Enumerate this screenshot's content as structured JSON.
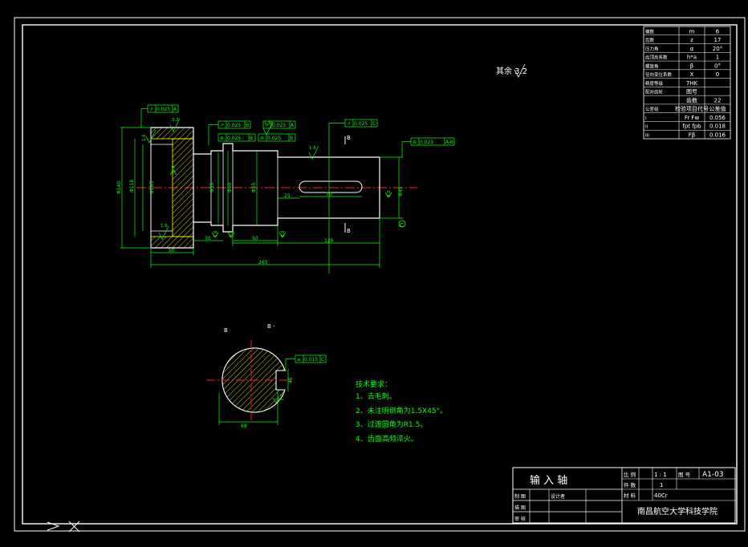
{
  "colors": {
    "background": "#000000",
    "frame": "#ffffff",
    "outline": "#ffffff",
    "dimension": "#00ff00",
    "centerline": "#ff2020",
    "hatch": "#ffff00",
    "text": "#ffffff",
    "note_text": "#00ff00"
  },
  "drawing": {
    "surface_finish_note": "其余 3.2",
    "roughness_values": [
      "3.2",
      "1.6",
      "1.6",
      "1.6",
      "1.6",
      "3.2",
      "3.2",
      "1.6",
      "1.6",
      "3.2",
      "3.2"
    ],
    "tolerance_frames": [
      {
        "symbol": "↗",
        "value": "0.025",
        "datum": "A"
      },
      {
        "symbol": "↗",
        "value": "0.025",
        "datum": "B"
      },
      {
        "symbol": "↗",
        "value": "0.025",
        "datum": "A"
      },
      {
        "symbol": "⊚",
        "value": "0.025",
        "datum": "B"
      },
      {
        "symbol": "⊚",
        "value": "0.025",
        "datum": "B"
      },
      {
        "symbol": "↗",
        "value": "0.025",
        "datum": "C"
      },
      {
        "symbol": "⊚",
        "value": "0.025",
        "datum": "A-B"
      },
      {
        "symbol": "≡",
        "value": "0.015",
        "datum": "C"
      }
    ],
    "dimensions": {
      "d140": "Φ140",
      "d118": "Φ118",
      "d105": "Φ105",
      "d55": "Φ55",
      "d50": "Φ50",
      "d45": "Φ45",
      "len_30": "30",
      "len_50": "50",
      "len_50b": "50",
      "len_120": "120",
      "len_70": "70",
      "len_25": "25",
      "len_265": "265",
      "section_width": "68",
      "section_depth": "45"
    },
    "section_labels": {
      "left": "B",
      "title": "B -",
      "cut_a": "B",
      "cut_b": "B"
    },
    "datum_label": "C"
  },
  "tech_requirements": {
    "title": "技术要求：",
    "items": [
      "1、去毛刺。",
      "2、未注明倒角为1.5X45°。",
      "3、过渡圆角为R1.5。",
      "4、齿面高频淬火。"
    ]
  },
  "param_table": {
    "rows": [
      [
        "模数",
        "m",
        "6"
      ],
      [
        "齿数",
        "z",
        "17"
      ],
      [
        "压力角",
        "α",
        "20°"
      ],
      [
        "齿顶高系数",
        "h*a",
        "1"
      ],
      [
        "螺旋角",
        "β",
        "0°"
      ],
      [
        "径向变位系数",
        "X",
        "0"
      ],
      [
        "精度等级",
        "7HK",
        ""
      ],
      [
        "配对齿轮",
        "图号",
        ""
      ],
      [
        "",
        "齿数",
        "22"
      ],
      [
        "公差组",
        "检验项目代号",
        "公差值"
      ],
      [
        "I",
        "Fr Fw",
        "0.056"
      ],
      [
        "II",
        "fpt fpb",
        "0.018"
      ],
      [
        "III",
        "Fβ",
        "0.016"
      ]
    ]
  },
  "title_block": {
    "part_name": "输 入 轴",
    "scale_label": "比 例",
    "scale_value": "1 : 1",
    "drawing_no_label": "图 号",
    "drawing_no": "A1-03",
    "qty_label": "件 数",
    "qty_value": "1",
    "material_label": "材 料",
    "material": "40Cr",
    "drawn_by": "制 图",
    "designer": "设计者",
    "checked_by": "描 图",
    "reviewed_by": "审 核",
    "school": "南昌航空大学科技学院"
  }
}
